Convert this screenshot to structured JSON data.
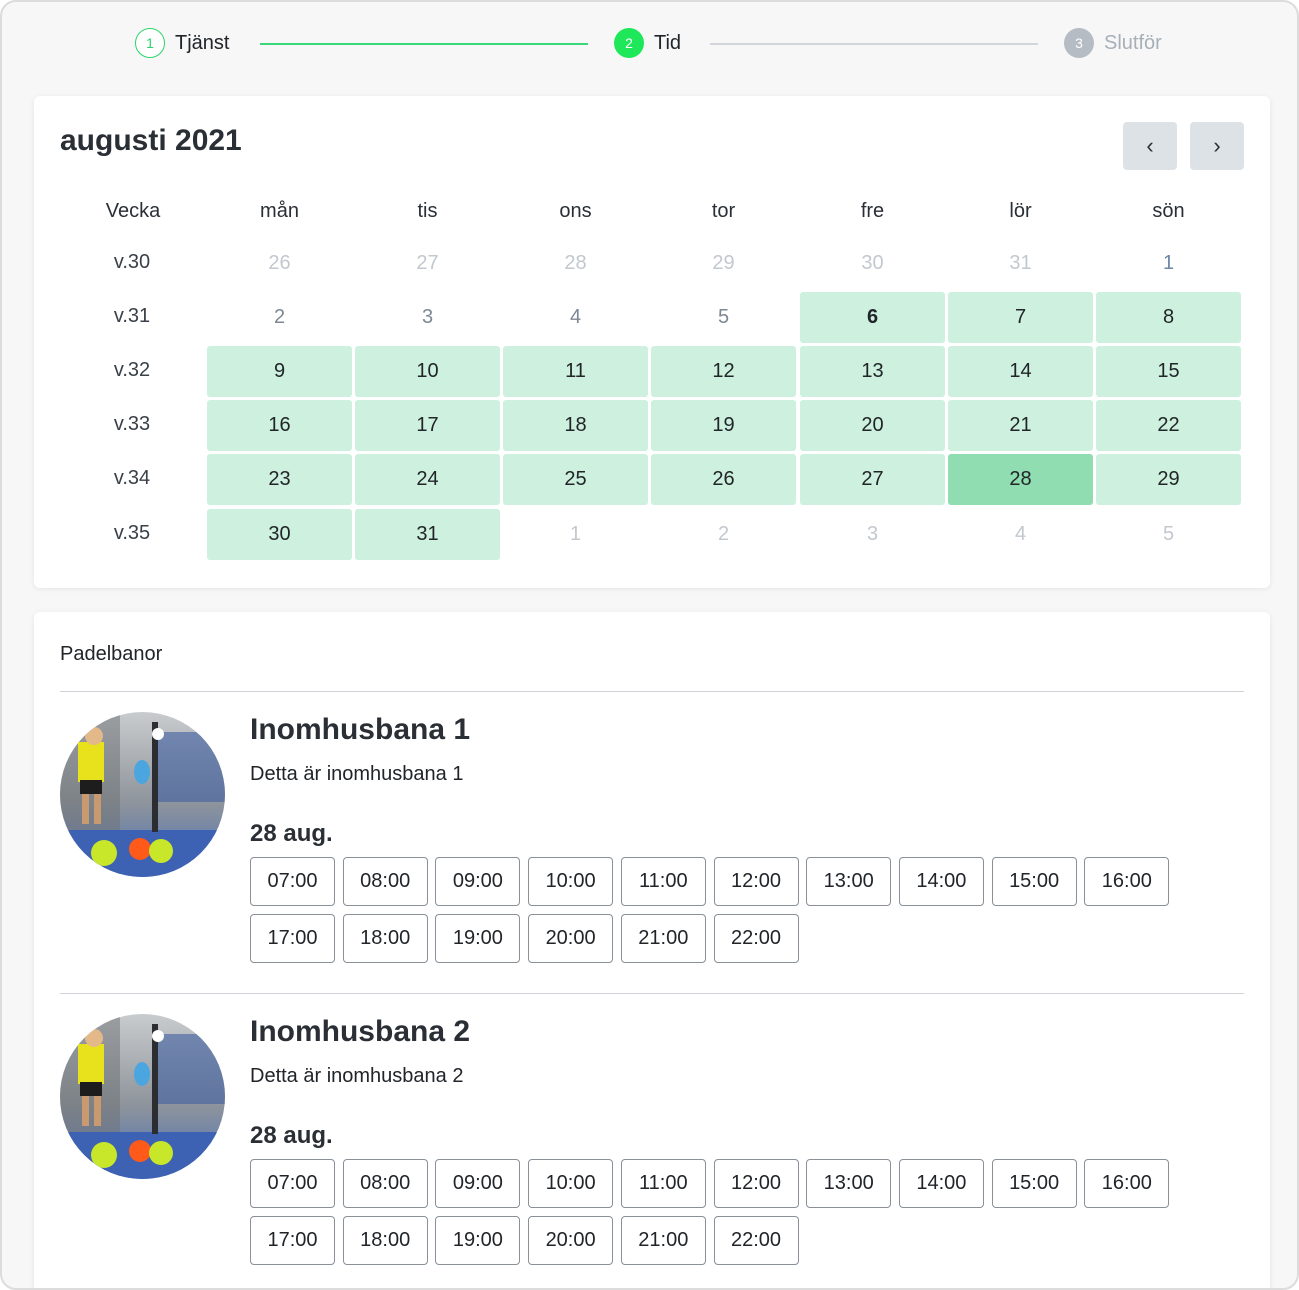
{
  "stepper": {
    "steps": [
      {
        "num": "1",
        "label": "Tjänst"
      },
      {
        "num": "2",
        "label": "Tid"
      },
      {
        "num": "3",
        "label": "Slutför"
      }
    ]
  },
  "calendar": {
    "month_title": "augusti 2021",
    "prev_label": "‹",
    "next_label": "›",
    "week_header": "Vecka",
    "weekdays": [
      "mån",
      "tis",
      "ons",
      "tor",
      "fre",
      "lör",
      "sön"
    ],
    "weeks": [
      {
        "label": "v.30",
        "days": [
          {
            "d": "26",
            "state": "muted"
          },
          {
            "d": "27",
            "state": "muted"
          },
          {
            "d": "28",
            "state": "muted"
          },
          {
            "d": "29",
            "state": "muted"
          },
          {
            "d": "30",
            "state": "muted"
          },
          {
            "d": "31",
            "state": "muted"
          },
          {
            "d": "1",
            "state": "blue"
          }
        ]
      },
      {
        "label": "v.31",
        "days": [
          {
            "d": "2",
            "state": "plain"
          },
          {
            "d": "3",
            "state": "plain"
          },
          {
            "d": "4",
            "state": "plain"
          },
          {
            "d": "5",
            "state": "plain"
          },
          {
            "d": "6",
            "state": "today"
          },
          {
            "d": "7",
            "state": "avail"
          },
          {
            "d": "8",
            "state": "avail"
          }
        ]
      },
      {
        "label": "v.32",
        "days": [
          {
            "d": "9",
            "state": "avail"
          },
          {
            "d": "10",
            "state": "avail"
          },
          {
            "d": "11",
            "state": "avail"
          },
          {
            "d": "12",
            "state": "avail"
          },
          {
            "d": "13",
            "state": "avail"
          },
          {
            "d": "14",
            "state": "avail"
          },
          {
            "d": "15",
            "state": "avail"
          }
        ]
      },
      {
        "label": "v.33",
        "days": [
          {
            "d": "16",
            "state": "avail"
          },
          {
            "d": "17",
            "state": "avail"
          },
          {
            "d": "18",
            "state": "avail"
          },
          {
            "d": "19",
            "state": "avail"
          },
          {
            "d": "20",
            "state": "avail"
          },
          {
            "d": "21",
            "state": "avail"
          },
          {
            "d": "22",
            "state": "avail"
          }
        ]
      },
      {
        "label": "v.34",
        "days": [
          {
            "d": "23",
            "state": "avail"
          },
          {
            "d": "24",
            "state": "avail"
          },
          {
            "d": "25",
            "state": "avail"
          },
          {
            "d": "26",
            "state": "avail"
          },
          {
            "d": "27",
            "state": "avail"
          },
          {
            "d": "28",
            "state": "selected"
          },
          {
            "d": "29",
            "state": "avail"
          }
        ]
      },
      {
        "label": "v.35",
        "days": [
          {
            "d": "30",
            "state": "avail"
          },
          {
            "d": "31",
            "state": "avail"
          },
          {
            "d": "1",
            "state": "muted"
          },
          {
            "d": "2",
            "state": "muted"
          },
          {
            "d": "3",
            "state": "muted"
          },
          {
            "d": "4",
            "state": "muted"
          },
          {
            "d": "5",
            "state": "muted"
          }
        ]
      }
    ]
  },
  "courts": {
    "title": "Padelbanor",
    "items": [
      {
        "name": "Inomhusbana 1",
        "description": "Detta är inomhusbana 1",
        "date": "28 aug.",
        "slots": [
          "07:00",
          "08:00",
          "09:00",
          "10:00",
          "11:00",
          "12:00",
          "13:00",
          "14:00",
          "15:00",
          "16:00",
          "17:00",
          "18:00",
          "19:00",
          "20:00",
          "21:00",
          "22:00"
        ]
      },
      {
        "name": "Inomhusbana 2",
        "description": "Detta är inomhusbana 2",
        "date": "28 aug.",
        "slots": [
          "07:00",
          "08:00",
          "09:00",
          "10:00",
          "11:00",
          "12:00",
          "13:00",
          "14:00",
          "15:00",
          "16:00",
          "17:00",
          "18:00",
          "19:00",
          "20:00",
          "21:00",
          "22:00"
        ]
      }
    ]
  },
  "colors": {
    "accent_green": "#1ee85a",
    "available_day": "#cdf1de",
    "selected_day": "#8fddb0",
    "nav_button": "#dde2e7"
  }
}
